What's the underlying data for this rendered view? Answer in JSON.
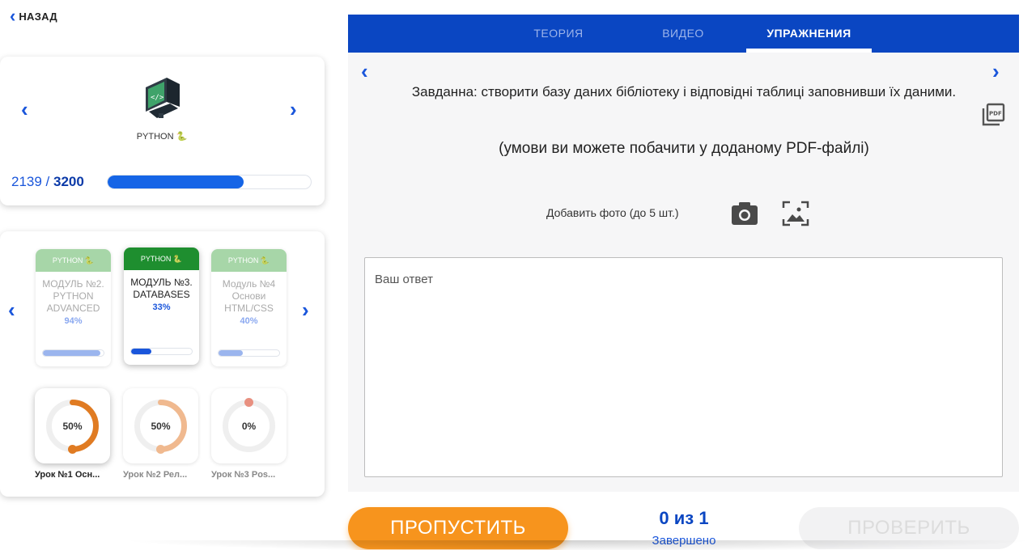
{
  "back": {
    "label": "НАЗАД"
  },
  "course": {
    "name": "PYTHON",
    "score_current": "2139",
    "score_separator": " / ",
    "score_max": "3200",
    "progress_fraction": 0.668
  },
  "modules": [
    {
      "header": "PYTHON",
      "title": "МОДУЛЬ №2. PYTHON ADVANCED",
      "percent": "94%",
      "progress_fraction": 0.94,
      "active": false
    },
    {
      "header": "PYTHON",
      "title": "МОДУЛЬ №3. DATABASES",
      "percent": "33%",
      "progress_fraction": 0.33,
      "active": true
    },
    {
      "header": "PYTHON",
      "title": "Модуль №4 Основи HTML/CSS",
      "percent": "40%",
      "progress_fraction": 0.4,
      "active": false
    }
  ],
  "lessons": [
    {
      "name": "Урок №1 Осн...",
      "percent": "50%",
      "progress_fraction": 0.5,
      "color": "#e07b22",
      "active": true
    },
    {
      "name": "Урок №2 Рел...",
      "percent": "50%",
      "progress_fraction": 0.5,
      "color": "#f0b98f",
      "active": false
    },
    {
      "name": "Урок №3 Pos...",
      "percent": "0%",
      "progress_fraction": 0.0,
      "color": "#e89080",
      "active": false
    }
  ],
  "tabs": [
    {
      "label": "ТЕОРИЯ",
      "active": false
    },
    {
      "label": "ВИДЕО",
      "active": false
    },
    {
      "label": "УПРАЖНЕНИЯ",
      "active": true
    }
  ],
  "task": {
    "text": "Завданна: створити базу даних бібліотеку і відповідні таблиці заповнивши їх даними.",
    "note": "(умови ви можете побачити у доданому PDF-файлі)",
    "add_photo_label": "Добавить фото (до 5 шт.)",
    "answer_placeholder": "Ваш ответ",
    "answer_value": ""
  },
  "footer": {
    "skip_label": "ПРОПУСТИТЬ",
    "progress_count": "0 из 1",
    "progress_label": "Завершено",
    "check_label": "ПРОВЕРИТЬ"
  },
  "icons": {
    "back": "chevron-left-icon",
    "course_logo": "computer-code-icon",
    "python_emoji": "snake-emoji-icon",
    "pdf": "pdf-file-icon",
    "camera": "camera-icon",
    "gallery": "image-gallery-icon"
  },
  "colors": {
    "primary": "#0a46c2",
    "accent_blue": "#1a56db",
    "skip_orange": "#f7941d",
    "module_green": "#1e8e2f",
    "module_green_light": "#a7d6a8"
  }
}
